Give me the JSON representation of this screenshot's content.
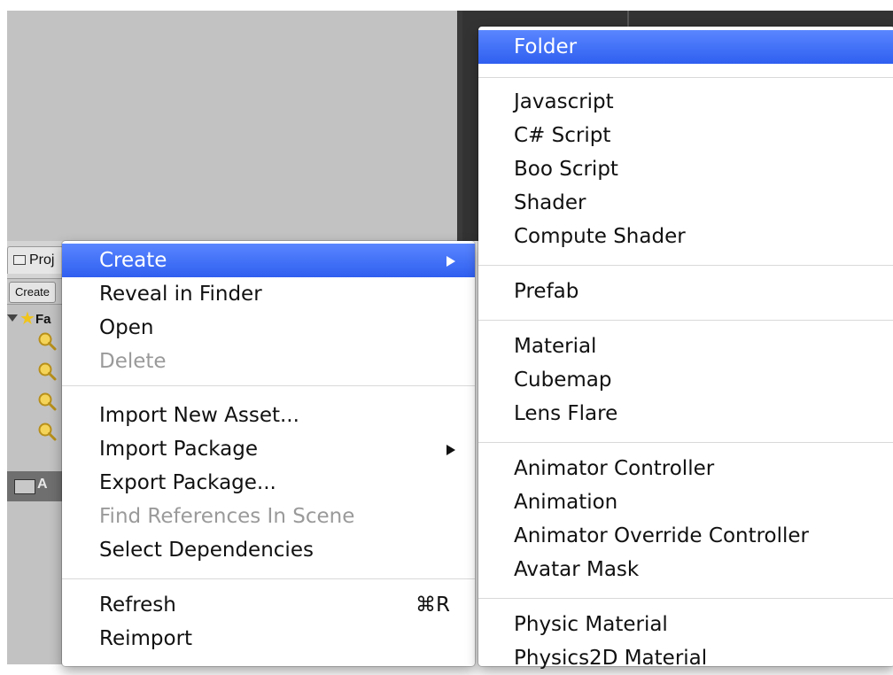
{
  "project_panel": {
    "tab_label": "Proj",
    "create_label": "Create",
    "favorites_label": "Fa",
    "assets_label": "A"
  },
  "context_menu": {
    "items": [
      {
        "label": "Create",
        "submenu": true,
        "highlighted": true
      },
      {
        "label": "Reveal in Finder"
      },
      {
        "label": "Open"
      },
      {
        "label": "Delete",
        "disabled": true
      },
      {
        "label": "Import New Asset..."
      },
      {
        "label": "Import Package",
        "submenu": true
      },
      {
        "label": "Export Package..."
      },
      {
        "label": "Find References In Scene",
        "disabled": true
      },
      {
        "label": "Select Dependencies"
      },
      {
        "label": "Refresh",
        "shortcut": "⌘R"
      },
      {
        "label": "Reimport"
      }
    ]
  },
  "create_submenu": {
    "items": [
      {
        "label": "Folder",
        "highlighted": true
      },
      {
        "label": "Javascript"
      },
      {
        "label": "C# Script"
      },
      {
        "label": "Boo Script"
      },
      {
        "label": "Shader"
      },
      {
        "label": "Compute Shader"
      },
      {
        "label": "Prefab"
      },
      {
        "label": "Material"
      },
      {
        "label": "Cubemap"
      },
      {
        "label": "Lens Flare"
      },
      {
        "label": "Animator Controller"
      },
      {
        "label": "Animation"
      },
      {
        "label": "Animator Override Controller"
      },
      {
        "label": "Avatar Mask"
      },
      {
        "label": "Physic Material"
      },
      {
        "label": "Physics2D Material"
      }
    ]
  },
  "colors": {
    "highlight": "#3b6cf5",
    "menu_bg": "#ffffff",
    "disabled_text": "#9a9a9a",
    "panel_bg": "#c2c2c2"
  }
}
